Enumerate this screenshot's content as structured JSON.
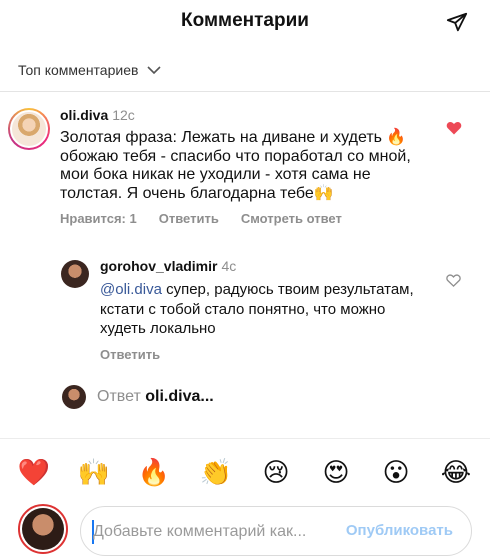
{
  "header": {
    "title": "Комментарии",
    "share_icon": "send-icon"
  },
  "sort": {
    "label": "Топ комментариев",
    "icon": "chevron-down-icon"
  },
  "comment": {
    "username": "oli.diva",
    "time": "12с",
    "text": "Золотая фраза: Лежать на диване и худеть 🔥 обожаю тебя - спасибо что поработал со мной, мои бока никак не уходили - хотя сама не толстая. Я очень благодарна тебе🙌",
    "likes_label": "Нравится: 1",
    "reply_label": "Ответить",
    "translate_label": "Смотреть ответ",
    "liked": true,
    "like_color": "#ed4956"
  },
  "reply": {
    "username": "gorohov_vladimir",
    "time": "4с",
    "mention": "@oli.diva",
    "text": " супер, радуюсь твоим результатам, кстати с тобой стало понятно, что можно худеть локально",
    "reply_label": "Ответить",
    "mention_color": "#385898"
  },
  "reply_to": {
    "prefix": "Ответ",
    "username": "oli.diva..."
  },
  "emoji_bar": [
    {
      "name": "red-heart",
      "glyph": "❤️"
    },
    {
      "name": "raising-hands",
      "glyph": "🙌"
    },
    {
      "name": "fire",
      "glyph": "🔥"
    },
    {
      "name": "clapping-hands",
      "glyph": "👏"
    },
    {
      "name": "crying-face",
      "glyph": "😢"
    },
    {
      "name": "heart-eyes",
      "glyph": "😍"
    },
    {
      "name": "astonished-face",
      "glyph": "😮"
    },
    {
      "name": "joy-face",
      "glyph": "😂"
    }
  ],
  "composer": {
    "placeholder": "Добавьте комментарий как...",
    "value": "",
    "publish_label": "Опубликовать",
    "publish_color": "#9fcaf5"
  }
}
